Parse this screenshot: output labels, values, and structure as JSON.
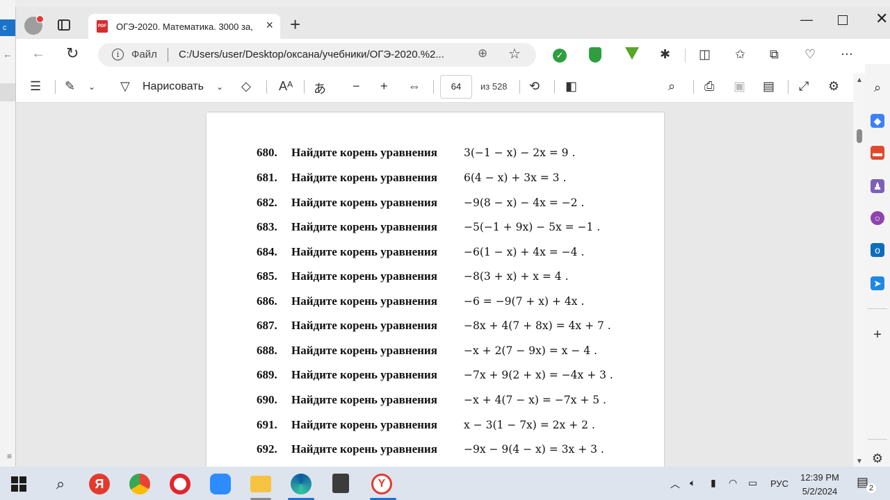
{
  "browser": {
    "tab_title": "ОГЭ-2020. Математика. 3000 за,",
    "tab_icon_label": "PDF",
    "url_prefix": "Файл",
    "url": "C:/Users/user/Desktop/оксана/учебники/ОГЭ-2020.%2..."
  },
  "pdf_toolbar": {
    "draw_label": "Нарисовать",
    "page_number": "64",
    "page_total": "из 528"
  },
  "problems": [
    {
      "num": "680.",
      "text": "Найдите корень уравнения",
      "eq": "3(−1 − x) − 2x = 9 ."
    },
    {
      "num": "681.",
      "text": "Найдите корень уравнения",
      "eq": "6(4 − x) + 3x = 3 ."
    },
    {
      "num": "682.",
      "text": "Найдите корень уравнения",
      "eq": "−9(8 − x) − 4x = −2 ."
    },
    {
      "num": "683.",
      "text": "Найдите корень уравнения",
      "eq": "−5(−1 + 9x) − 5x = −1 ."
    },
    {
      "num": "684.",
      "text": "Найдите корень уравнения",
      "eq": "−6(1 − x) + 4x = −4 ."
    },
    {
      "num": "685.",
      "text": "Найдите корень уравнения",
      "eq": "−8(3 + x) + x = 4 ."
    },
    {
      "num": "686.",
      "text": "Найдите корень уравнения",
      "eq": "−6 = −9(7 + x) + 4x ."
    },
    {
      "num": "687.",
      "text": "Найдите корень уравнения",
      "eq": "−8x + 4(7 + 8x) = 4x + 7 ."
    },
    {
      "num": "688.",
      "text": "Найдите корень уравнения",
      "eq": "−x + 2(7 − 9x) = x − 4 ."
    },
    {
      "num": "689.",
      "text": "Найдите корень уравнения",
      "eq": "−7x + 9(2 + x) = −4x + 3 ."
    },
    {
      "num": "690.",
      "text": "Найдите корень уравнения",
      "eq": "−x + 4(7 − x) = −7x + 5 ."
    },
    {
      "num": "691.",
      "text": "Найдите корень уравнения",
      "eq": "x − 3(1 − 7x) = 2x + 2 ."
    },
    {
      "num": "692.",
      "text": "Найдите корень уравнения",
      "eq": "−9x − 9(4 − x) = 3x + 3 ."
    }
  ],
  "taskbar": {
    "yandex_label": "Я",
    "language": "РУС",
    "time": "12:39 PM",
    "date": "5/2/2024",
    "notification_count": "2"
  },
  "colors": {
    "accent": "#1f6fd1",
    "pdf_red": "#d32f2f",
    "extension_green": "#2e9e3e"
  }
}
